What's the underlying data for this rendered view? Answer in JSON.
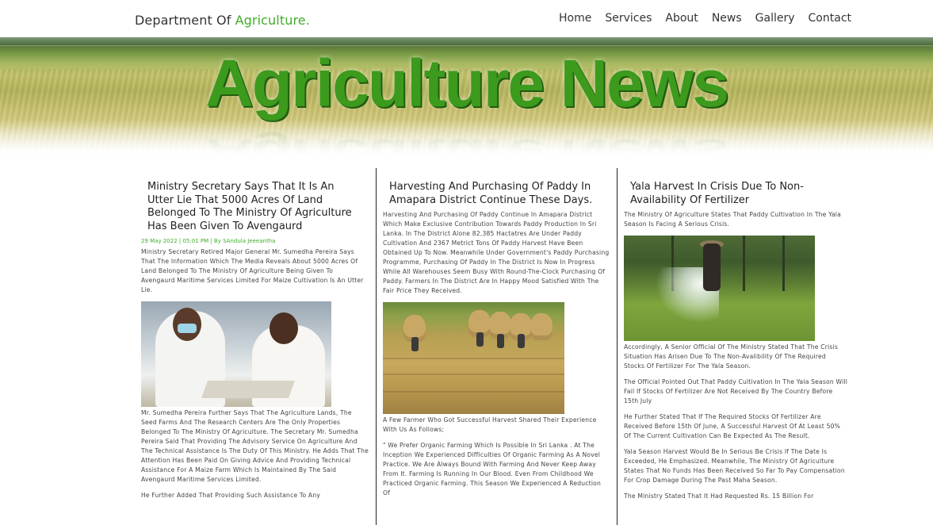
{
  "header": {
    "brand_prefix": "Department Of ",
    "brand_accent": "Agriculture.",
    "nav": [
      "Home",
      "Services",
      "About",
      "News",
      "Gallery",
      "Contact"
    ]
  },
  "banner": {
    "title": "Agriculture News"
  },
  "colors": {
    "accent": "#3fae29",
    "banner_text": "#3c9a1d",
    "column_divider": "#222222"
  },
  "articles": [
    {
      "title": "Ministry Secretary Says That It Is An Utter Lie That 5000 Acres Of Land Belonged To The Ministry Of Agriculture Has Been Given To Avengaurd",
      "meta": "29 May 2022 | 05:01 PM | By SAndula Jeeeantha",
      "intro": "Ministry Secretary Retired Major General Mr. Sumedha Pereira Says That The Information Which The Media Reveals About 5000 Acres Of Land Belonged To The Ministry Of Agriculture Being Given To Avengaurd Maritime Services Limited For Maize Cultivation Is An Utter Lie.",
      "after_image": "Mr. Sumedha Pereira Further Says That The Agriculture Lands, The Seed Farms And The Research Centers Are The Only Properties Belonged To The Ministry Of Agriculture. The Secretary Mr. Sumedha Pereira Said That Providing The Advisory Service On Agriculture And The Technical Assistance Is The Duty Of This Ministry. He Adds That The Attention Has Been Paid On Giving Advice And Providing Technical Assistance For A Maize Farm Which Is Maintained By The Said Avengaurd Maritime Services Limited.",
      "more": "He Further Added That Providing Such Assistance To Any"
    },
    {
      "title": "Harvesting And Purchasing Of Paddy In Amapara District Continue These Days.",
      "intro": "Harvesting And Purchasing Of Paddy Continue In Amapara District Which Make Exclusive Contribution Towards Paddy Production In Sri Lanka. In The District Alone 82,385 Hactatres Are Under Paddy Cultivation And 2367 Metrict Tons Of Paddy Harvest Have Been Obtained Up To Now. Meanwhile Under Government's Paddy Purchasing Programme, Purchasing Of Paddy In The District Is Now In Progress While All Warehouses Seem Busy With Round-The-Clock Purchasing Of Paddy. Farmers In The District Are In Happy Mood Satisfied With The Fair Price They Received.",
      "after_image": "A Few Farmer Who Got Successful Harvest Shared Their Experience With Us As Follows;",
      "more": "\" We Prefer Organic Farming Which Is Possible In Sri Lanka . At The Inception We Experienced Difficulties Of Organic Farming As A Novel Practice. We Are Always Bound With Farming And Never Keep Away From It. Farming Is Running In Our Blood. Even From Childhood We Practiced Organic Farming. This Season We Experienced A Reduction Of"
    },
    {
      "title": "Yala Harvest In Crisis Due To Non-Availability Of Fertilizer",
      "intro": "The Ministry Of Agriculture States That Paddy Cultivation In The Yala Season Is Facing A Serious Crisis.",
      "paragraphs": [
        "Accordingly, A Senior Official Of The Ministry Stated That The Crisis Situation Has Arisen Due To The Non-Avalibility Of The Required Stocks Of Fertilizer For The Yala Season.",
        "The Official Pointed Out That Paddy Cultivation In The Yala Season Will Fail If Stocks Of Fertilizer Are Not Received By The Country Before 15th July",
        "He Further Stated That If The Required Stocks Of Fertilizer Are Received Before 15th Of June, A Successful Harvest Of At Least 50% Of The Current Cultivation Can Be Expected As The Result.",
        "Yala Season Harvest Would Be In Serious Be Crisis If The Date Is Exceeded, He Emphasized. Meanwhile, The Ministry Of Agriculture States That No Funds Has Been Received So Far To Pay Compensation For Crop Damage During The Past Maha Season.",
        "The Ministry Stated That It Had Requested Rs. 15 Billion For"
      ]
    }
  ]
}
